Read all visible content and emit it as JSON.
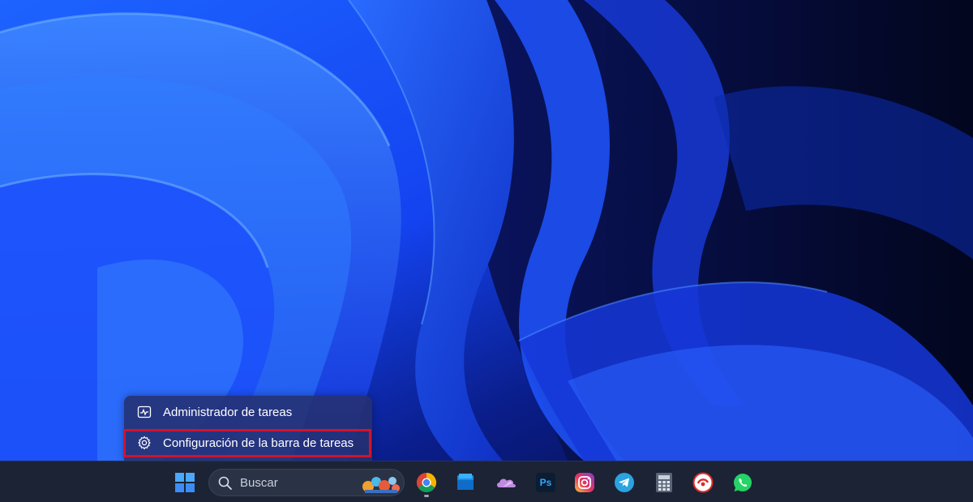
{
  "context_menu": {
    "items": [
      {
        "label": "Administrador de tareas",
        "icon": "task-manager-icon"
      },
      {
        "label": "Configuración de la barra de tareas",
        "icon": "gear-icon"
      }
    ],
    "highlight_color": "#d0142c"
  },
  "taskbar": {
    "search": {
      "placeholder": "Buscar"
    },
    "apps": [
      {
        "name": "start",
        "icon": "windows-logo-icon"
      },
      {
        "name": "chrome",
        "icon": "chrome-icon"
      },
      {
        "name": "explorer",
        "icon": "file-explorer-icon"
      },
      {
        "name": "onedrive",
        "icon": "onedrive-icon"
      },
      {
        "name": "photoshop",
        "icon": "photoshop-icon",
        "label": "Ps"
      },
      {
        "name": "instagram",
        "icon": "instagram-icon"
      },
      {
        "name": "telegram",
        "icon": "telegram-icon"
      },
      {
        "name": "calculator",
        "icon": "calculator-icon"
      },
      {
        "name": "app-red",
        "icon": "red-app-icon"
      },
      {
        "name": "whatsapp",
        "icon": "whatsapp-icon"
      }
    ]
  },
  "colors": {
    "taskbar_bg": "#1b2334",
    "wallpaper_accent": "#1e4bff",
    "menu_bg": "#263070"
  }
}
